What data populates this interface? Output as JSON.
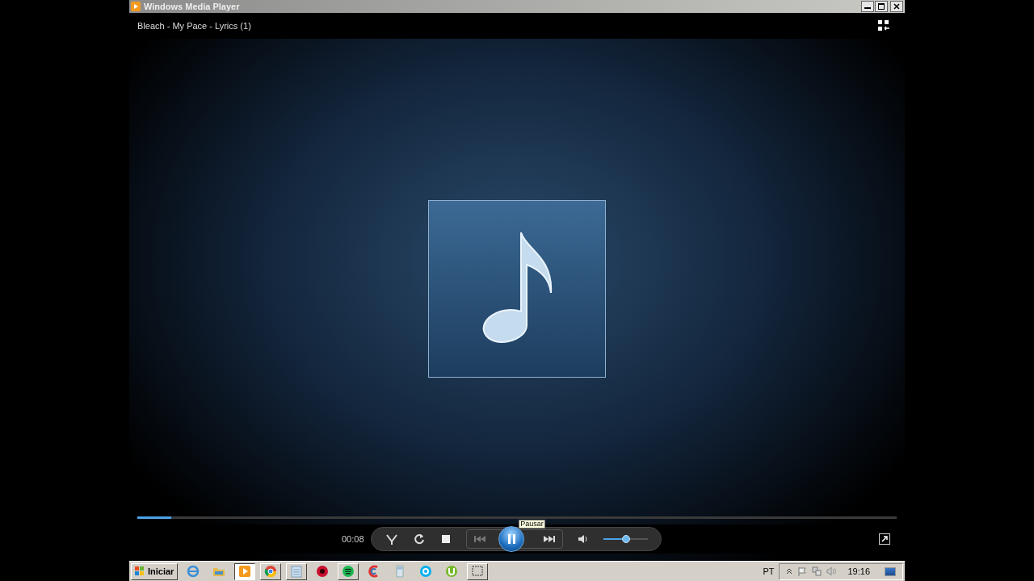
{
  "window": {
    "title": "Windows Media Player"
  },
  "now_playing": {
    "title": "Bleach - My Pace - Lyrics (1)"
  },
  "seek": {
    "level": 0.045
  },
  "controls": {
    "time": "00:08",
    "tooltip": "Pausar",
    "volume": {
      "level": 0.5
    }
  },
  "taskbar": {
    "start_label": "Iniciar",
    "apps": [
      {
        "running": false,
        "selected": false
      },
      {
        "running": false,
        "selected": false
      },
      {
        "running": true,
        "selected": true
      },
      {
        "running": true,
        "selected": false
      },
      {
        "running": true,
        "selected": false
      },
      {
        "running": false,
        "selected": false
      },
      {
        "running": true,
        "selected": false
      },
      {
        "running": false,
        "selected": false
      },
      {
        "running": false,
        "selected": false
      },
      {
        "running": false,
        "selected": false
      },
      {
        "running": false,
        "selected": false
      },
      {
        "running": true,
        "selected": false
      }
    ],
    "language": "PT",
    "clock": "19:16"
  }
}
